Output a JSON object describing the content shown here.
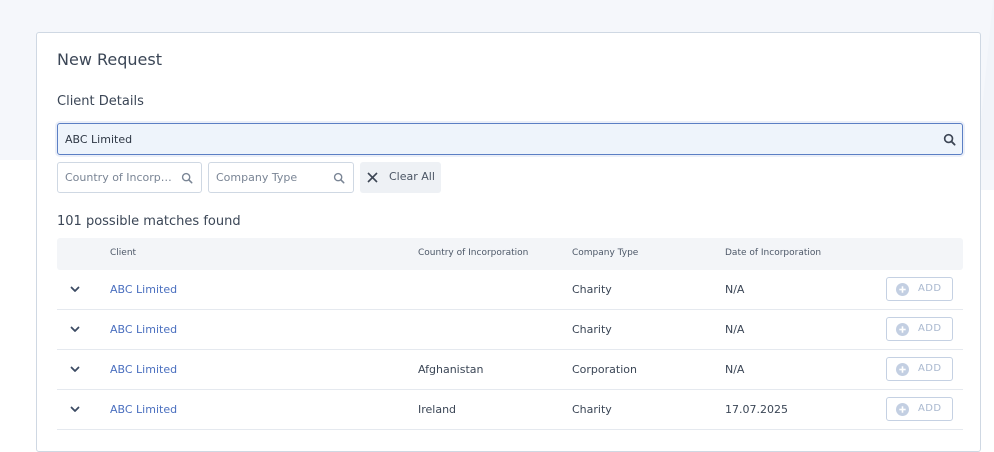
{
  "page": {
    "title": "New Request",
    "section_title": "Client Details"
  },
  "search": {
    "value": "ABC Limited",
    "icon": "search-icon"
  },
  "filters": [
    {
      "placeholder": "Country of Incorporation",
      "display": "Country of Incorpo...",
      "icon": "search-icon"
    },
    {
      "placeholder": "Company Type",
      "display": "Company Type",
      "icon": "search-icon"
    }
  ],
  "clear_all": {
    "label": "Clear All",
    "icon": "close-icon"
  },
  "results": {
    "summary": "101 possible matches found",
    "columns": [
      "Client",
      "Country of Incorporation",
      "Company Type",
      "Date of Incorporation"
    ],
    "add_label": "ADD",
    "rows": [
      {
        "client": "ABC Limited",
        "country": "",
        "type": "Charity",
        "date": "N/A"
      },
      {
        "client": "ABC Limited",
        "country": "",
        "type": "Charity",
        "date": "N/A"
      },
      {
        "client": "ABC Limited",
        "country": "Afghanistan",
        "type": "Corporation",
        "date": "N/A"
      },
      {
        "client": "ABC Limited",
        "country": "Ireland",
        "type": "Charity",
        "date": "17.07.2025"
      }
    ]
  },
  "colors": {
    "accent": "#5b7fc4",
    "link": "#4a6fbf",
    "add_disabled": "#a9b8cf",
    "header_bg": "#f3f5f8",
    "page_bg": "#f5f7fb"
  }
}
